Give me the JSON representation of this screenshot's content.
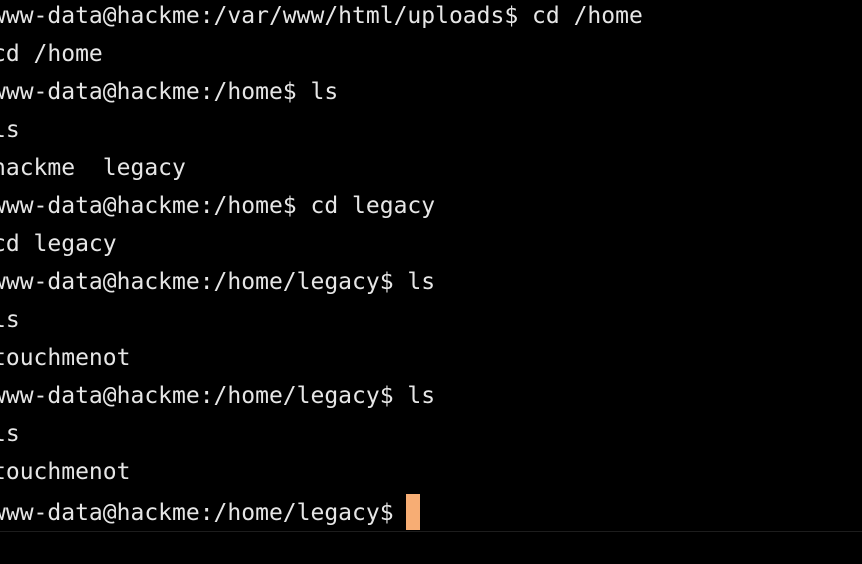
{
  "terminal": {
    "lines": [
      "www-data@hackme:/var/www/html/uploads$ cd /home",
      "cd /home",
      "www-data@hackme:/home$ ls",
      "ls",
      "hackme  legacy",
      "www-data@hackme:/home$ cd legacy",
      "cd legacy",
      "www-data@hackme:/home/legacy$ ls",
      "ls",
      "touchmenot",
      "www-data@hackme:/home/legacy$ ls",
      "ls",
      "touchmenot"
    ],
    "prompt": "www-data@hackme:/home/legacy$",
    "cursor_color": "#f7ad74",
    "background_color": "#000000",
    "text_color": "#e6e6e6"
  }
}
